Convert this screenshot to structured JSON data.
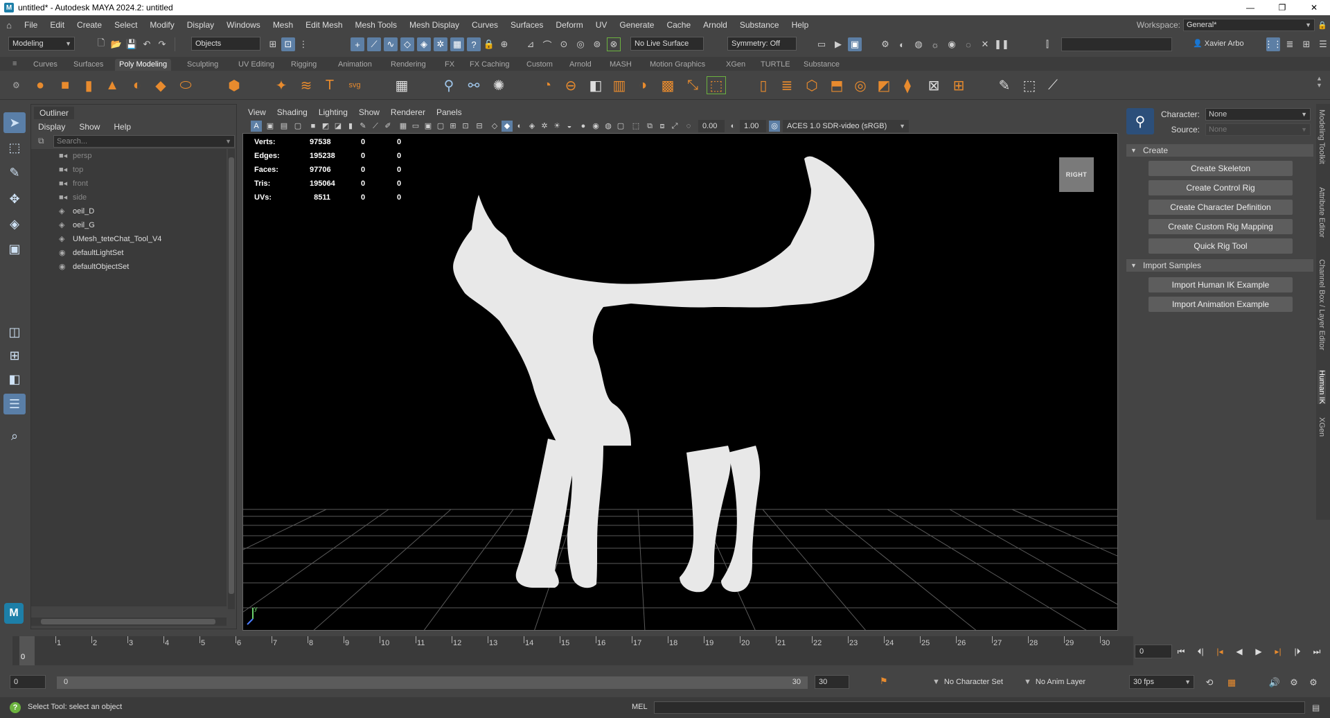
{
  "window": {
    "title": "untitled* - Autodesk MAYA 2024.2: untitled",
    "app_icon": "M"
  },
  "menubar": {
    "items": [
      "File",
      "Edit",
      "Create",
      "Select",
      "Modify",
      "Display",
      "Windows",
      "Mesh",
      "Edit Mesh",
      "Mesh Tools",
      "Mesh Display",
      "Curves",
      "Surfaces",
      "Deform",
      "UV",
      "Generate",
      "Cache",
      "Arnold",
      "Substance",
      "Help"
    ]
  },
  "workspace": {
    "label": "Workspace:",
    "value": "General*"
  },
  "statusline": {
    "mode": "Modeling",
    "select_mode": "Objects",
    "live_surface": "No Live Surface",
    "symmetry": "Symmetry: Off",
    "user": "Xavier Arbo"
  },
  "shelf": {
    "tabs": [
      "Curves",
      "Surfaces",
      "Poly Modeling",
      "Sculpting",
      "UV Editing",
      "Rigging",
      "Animation",
      "Rendering",
      "FX",
      "FX Caching",
      "Custom",
      "Arnold",
      "MASH",
      "Motion Graphics",
      "XGen",
      "TURTLE",
      "Substance"
    ],
    "active_tab": "Poly Modeling"
  },
  "outliner": {
    "tab": "Outliner",
    "menu": [
      "Display",
      "Show",
      "Help"
    ],
    "search_placeholder": "Search...",
    "items": [
      {
        "name": "persp",
        "icon": "camera-icon",
        "dim": true
      },
      {
        "name": "top",
        "icon": "camera-icon",
        "dim": true
      },
      {
        "name": "front",
        "icon": "camera-icon",
        "dim": true
      },
      {
        "name": "side",
        "icon": "camera-icon",
        "dim": true
      },
      {
        "name": "oeil_D",
        "icon": "mesh-icon",
        "dim": false
      },
      {
        "name": "oeil_G",
        "icon": "mesh-icon",
        "dim": false
      },
      {
        "name": "UMesh_teteChat_Tool_V4",
        "icon": "mesh-icon",
        "dim": false
      },
      {
        "name": "defaultLightSet",
        "icon": "set-icon",
        "dim": false
      },
      {
        "name": "defaultObjectSet",
        "icon": "set-icon",
        "dim": false
      }
    ]
  },
  "viewport": {
    "menu": [
      "View",
      "Shading",
      "Lighting",
      "Show",
      "Renderer",
      "Panels"
    ],
    "field_a": "0.00",
    "field_b": "1.00",
    "color_space": "ACES 1.0 SDR-video (sRGB)",
    "view_cube_label": "RIGHT",
    "hud": [
      {
        "label": "Verts:",
        "v1": "97538",
        "v2": "0",
        "v3": "0"
      },
      {
        "label": "Edges:",
        "v1": "195238",
        "v2": "0",
        "v3": "0"
      },
      {
        "label": "Faces:",
        "v1": "97706",
        "v2": "0",
        "v3": "0"
      },
      {
        "label": "Tris:",
        "v1": "195064",
        "v2": "0",
        "v3": "0"
      },
      {
        "label": "UVs:",
        "v1": "8511",
        "v2": "0",
        "v3": "0"
      }
    ]
  },
  "hik": {
    "character_label": "Character:",
    "character_value": "None",
    "source_label": "Source:",
    "source_value": "None",
    "sections": [
      {
        "title": "Create",
        "buttons": [
          "Create Skeleton",
          "Create Control Rig",
          "Create Character Definition",
          "Create Custom Rig Mapping",
          "Quick Rig Tool"
        ]
      },
      {
        "title": "Import Samples",
        "buttons": [
          "Import Human IK Example",
          "Import Animation Example"
        ]
      }
    ]
  },
  "side_tabs": [
    "Modeling Toolkit",
    "Attribute Editor",
    "Channel Box / Layer Editor",
    "Human IK",
    "XGen"
  ],
  "timeline": {
    "start_field": "0",
    "frames": [
      "0",
      "1",
      "2",
      "3",
      "4",
      "5",
      "6",
      "7",
      "8",
      "9",
      "10",
      "11",
      "12",
      "13",
      "14",
      "15",
      "16",
      "17",
      "18",
      "19",
      "20",
      "21",
      "22",
      "23",
      "24",
      "25",
      "26",
      "27",
      "28",
      "29",
      "30"
    ],
    "current_frame": "0",
    "playhead_label": "0"
  },
  "range": {
    "start": "0",
    "slider_start": "0",
    "slider_end": "30",
    "end": "30",
    "character_set": "No Character Set",
    "anim_layer": "No Anim Layer",
    "fps": "30 fps"
  },
  "helpline": {
    "text": "Select Tool: select an object",
    "mel_label": "MEL"
  }
}
